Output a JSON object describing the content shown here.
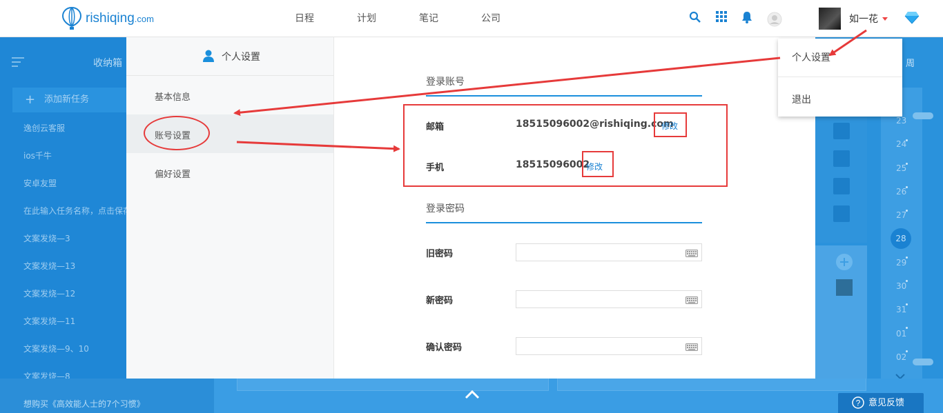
{
  "header": {
    "logo_text": "rishiqing",
    "logo_suffix": ".com",
    "nav": [
      "日程",
      "计划",
      "笔记",
      "公司"
    ],
    "username": "如一花"
  },
  "dropdown": {
    "items": [
      "个人设置",
      "退出"
    ]
  },
  "background": {
    "inbox_title": "收纳箱",
    "add_task": "添加新任务",
    "tasks": [
      "逸创云客服",
      "ios千牛",
      "安卓友盟",
      "在此输入任务名称，点击保存",
      "文案发烧—3",
      "文案发烧—13",
      "文案发烧—12",
      "文案发烧—11",
      "文案发烧—9、10",
      "文案发烧—8",
      "想购买《高效能人士的7个习惯》"
    ],
    "week_label": "周",
    "dates": [
      "23",
      "24",
      "25",
      "26",
      "27",
      "28",
      "29",
      "30",
      "31",
      "01",
      "02"
    ],
    "feedback": "意见反馈"
  },
  "modal": {
    "title": "个人设置",
    "menu": [
      "基本信息",
      "账号设置",
      "偏好设置"
    ],
    "login_account_title": "登录账号",
    "email_label": "邮箱",
    "email_value": "18515096002@rishiqing.com",
    "phone_label": "手机",
    "phone_value": "18515096002",
    "edit_label": "修改",
    "password_title": "登录密码",
    "old_pw_label": "旧密码",
    "new_pw_label": "新密码",
    "confirm_pw_label": "确认密码"
  },
  "colors": {
    "accent": "#1a82d2",
    "annotation_red": "#e63a3a"
  }
}
